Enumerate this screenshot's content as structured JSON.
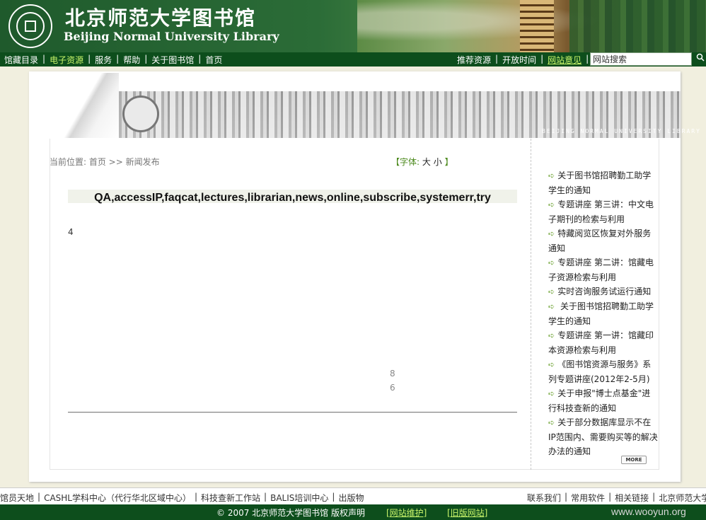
{
  "header": {
    "logo_cn": "北京师范大学图书馆",
    "logo_en": "Beijing Normal University Library"
  },
  "nav": {
    "left": [
      "馆藏目录",
      "电子资源",
      "服务",
      "帮助",
      "关于图书馆",
      "首页"
    ],
    "right": [
      "推荐资源",
      "开放时间",
      "网站意见"
    ],
    "search_value": "网站搜索"
  },
  "banner": {
    "text": "BEIJING NORMAL UNIVERSITY LIBRARY"
  },
  "breadcrumb": "当前位置: 首页 >> 新闻发布",
  "font_ctl": {
    "label": "【字体:",
    "big": "大",
    "small": "小",
    "close": "】"
  },
  "article": {
    "title": "QA,accessIP,faqcat,lectures,librarian,news,online,subscribe,systemerr,try",
    "num1": "4",
    "num2": "8",
    "num3": "6"
  },
  "news": [
    "关于图书馆招聘勤工助学学生的通知",
    "专题讲座 第三讲：中文电子期刊的检索与利用",
    "特藏阅览区恢复对外服务通知",
    "专题讲座 第二讲：馆藏电子资源检索与利用",
    "实时咨询服务试运行通知",
    " 关于图书馆招聘勤工助学学生的通知",
    "专题讲座 第一讲：馆藏印本资源检索与利用",
    "《图书馆资源与服务》系列专题讲座(2012年2-5月)",
    "关于申报\"博士点基金\"进行科技查新的通知",
    "关于部分数据库显示不在IP范围内、需要购买等的解决办法的通知"
  ],
  "more_label": "MORE",
  "footer": {
    "left_links": [
      "馆员天地",
      "CASHL学科中心（代行华北区域中心）",
      "科技查新工作站",
      "BALIS培训中心",
      "出版物"
    ],
    "right_links": [
      "联系我们",
      "常用软件",
      "相关链接",
      "北京师范大学"
    ],
    "copyright": "© 2007 北京师范大学图书馆 版权声明",
    "maintain": "[网站维护]",
    "old_site": "[旧版网站]",
    "watermark": "www.wooyun.org"
  },
  "colors": {
    "header_green": "#1f5a2c",
    "nav_green": "#0d4e1c",
    "link_highlight": "#c9f56a",
    "arrow_green": "#6aa02e",
    "page_bg": "#f1efdf"
  }
}
